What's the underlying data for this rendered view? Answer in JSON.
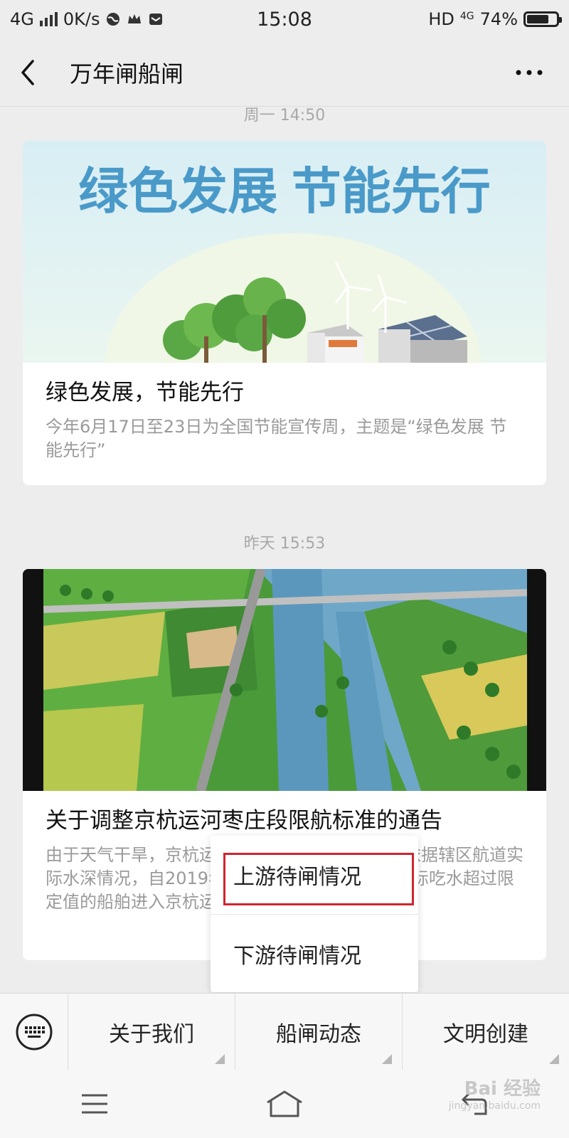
{
  "status_bar": {
    "network": "4G",
    "speed": "0K/s",
    "time": "15:08",
    "hd": "HD",
    "net_right": "4G",
    "battery": "74%",
    "battery_level": 0.74
  },
  "nav": {
    "title": "万年闸船闸",
    "back_icon": "chevron-left-icon",
    "more_icon": "more-dots-icon"
  },
  "feed": [
    {
      "timestamp": "周一 14:50",
      "banner_text": "绿色发展 节能先行",
      "title": "绿色发展，节能先行",
      "desc": "今年6月17日至23日为全国节能宣传周，主题是“绿色发展 节能先行”"
    },
    {
      "timestamp": "昨天 15:53",
      "title": "关于调整京杭运河枣庄段限航标准的通告",
      "desc": "由于天气干旱，京杭运河枣庄段水位持续下降。依据辖区航道实际水深情况，自2019年6月23日零时起，禁止实际吃水超过限定值的船舶进入京杭运河枣庄段。"
    }
  ],
  "popup_menu": {
    "items": [
      "上游待闸情况",
      "下游待闸情况"
    ],
    "highlight_color": "#d0252f"
  },
  "bottom_menu": {
    "keyboard_icon": "keyboard-icon",
    "items": [
      "关于我们",
      "船闸动态",
      "文明创建"
    ]
  },
  "system_nav": {
    "icons": [
      "menu-icon",
      "home-icon",
      "back-icon"
    ]
  },
  "watermark": {
    "text": "Bai 经验",
    "url": "jingyan.baidu.com"
  }
}
